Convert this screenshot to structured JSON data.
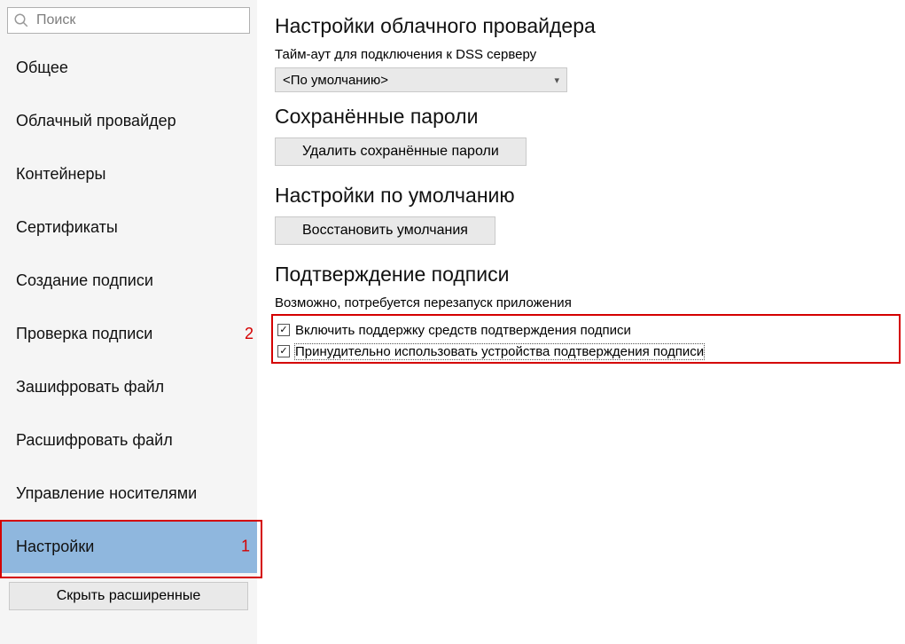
{
  "sidebar": {
    "search_placeholder": "Поиск",
    "items": [
      {
        "label": "Общее"
      },
      {
        "label": "Облачный провайдер"
      },
      {
        "label": "Контейнеры"
      },
      {
        "label": "Сертификаты"
      },
      {
        "label": "Создание подписи"
      },
      {
        "label": "Проверка подписи"
      },
      {
        "label": "Зашифровать файл"
      },
      {
        "label": "Расшифровать файл"
      },
      {
        "label": "Управление носителями"
      },
      {
        "label": "Настройки",
        "selected": true
      }
    ],
    "hide_advanced_label": "Скрыть расширенные"
  },
  "main": {
    "cloud": {
      "title": "Настройки облачного провайдера",
      "timeout_label": "Тайм-аут для подключения к DSS серверу",
      "timeout_value": "<По умолчанию>"
    },
    "passwords": {
      "title": "Сохранённые пароли",
      "delete_btn": "Удалить сохранённые пароли"
    },
    "defaults": {
      "title": "Настройки по умолчанию",
      "restore_btn": "Восстановить умолчания"
    },
    "confirm": {
      "title": "Подтверждение подписи",
      "hint": "Возможно, потребуется перезапуск приложения",
      "opt1": "Включить поддержку средств подтверждения подписи",
      "opt2": "Принудительно использовать устройства подтверждения подписи"
    }
  },
  "annotations": {
    "n1": "1",
    "n2": "2"
  }
}
